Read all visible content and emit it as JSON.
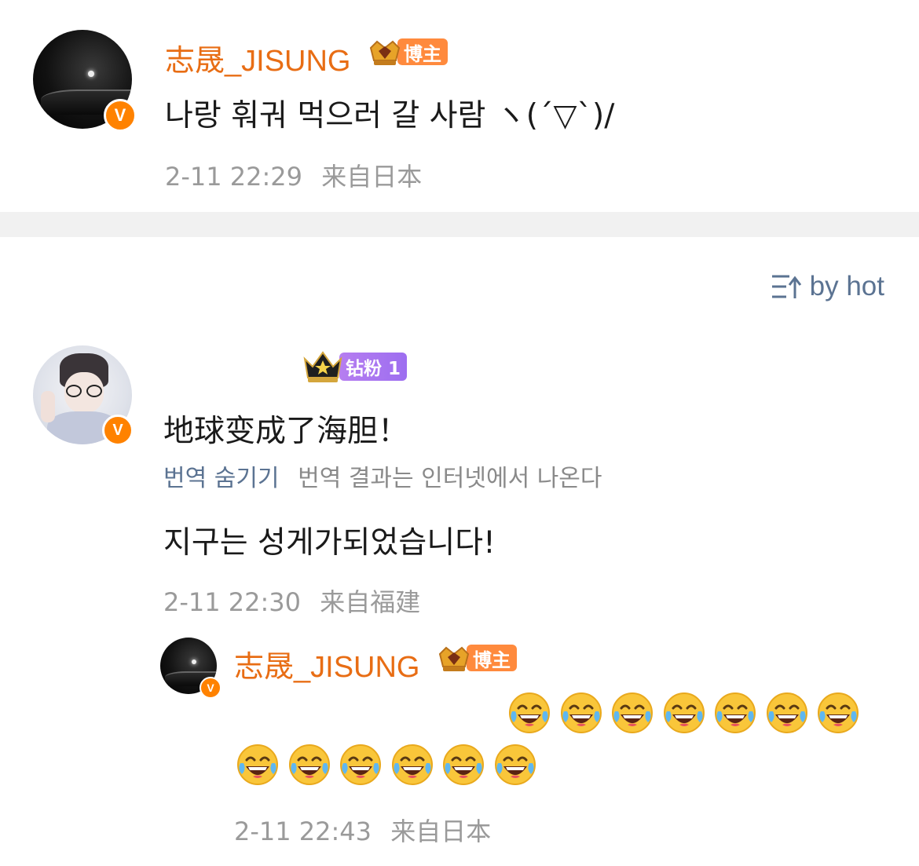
{
  "post": {
    "author": "志晟_JISUNG",
    "author_badge": "博主",
    "text": "나랑 훠궈 먹으러 갈 사람 ヽ(´▽`)/",
    "time": "2-11 22:29",
    "source": "来自日本"
  },
  "sort": {
    "label": "by hot",
    "icon": "sort-icon"
  },
  "comment": {
    "author": "",
    "fan_badge": "钻粉 1",
    "text": "地球变成了海胆！",
    "translation_toggle": "번역 숨기기",
    "translation_note": "번역 결과는 인터넷에서 나온다",
    "translated_text": "지구는 성게가되었습니다!",
    "time": "2-11 22:30",
    "source": "来自福建"
  },
  "reply": {
    "author": "志晟_JISUNG",
    "author_badge": "博主",
    "emoji_name": "laughing-crying-emoji",
    "emoji_count_row1": 7,
    "emoji_count_row2": 6,
    "time": "2-11 22:43",
    "source": "来自日本"
  },
  "colors": {
    "name_orange": "#e86d14",
    "badge_orange": "#ff8a3d",
    "fan_purple": "#b67ef0",
    "link_blue": "#5b7392",
    "meta_gray": "#9a9a9a",
    "divider": "#f1f1f1"
  }
}
